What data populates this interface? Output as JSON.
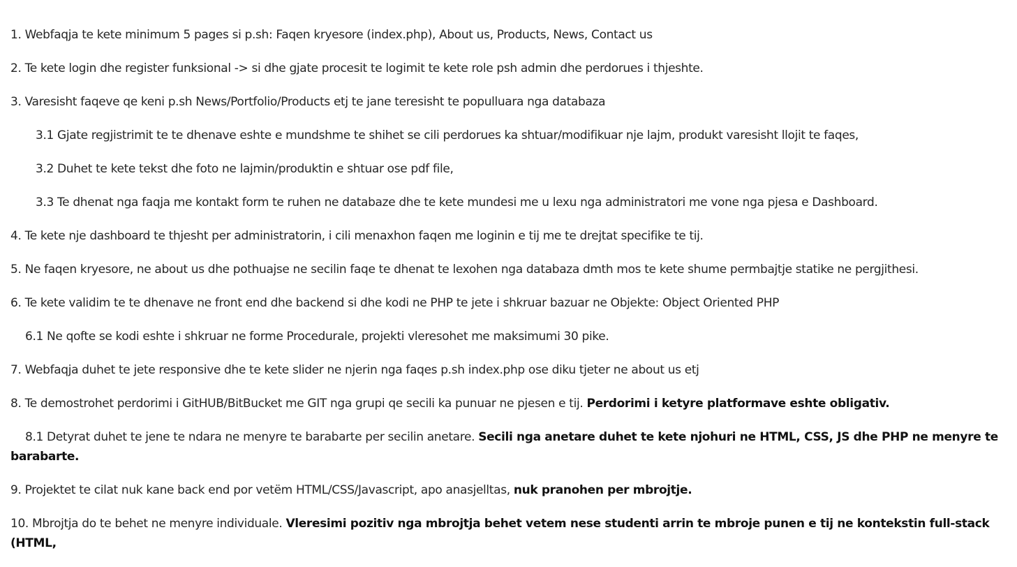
{
  "requirements": [
    {
      "text": "1. Webfaqja te kete minimum 5 pages si p.sh: Faqen kryesore (index.php), About us, Products, News, Contact us",
      "bold": ""
    },
    {
      "text": "2. Te kete login dhe register funksional -> si dhe gjate procesit te logimit te kete role psh admin dhe perdorues i thjeshte.",
      "bold": ""
    },
    {
      "text": "3. Varesisht faqeve qe keni p.sh News/Portfolio/Products etj te jane teresisht te populluara nga databaza",
      "bold": ""
    },
    {
      "text": "3.1 Gjate regjistrimit te te dhenave eshte e mundshme te shihet se cili perdorues ka shtuar/modifikuar nje lajm, produkt varesisht llojit te faqes,",
      "bold": ""
    },
    {
      "text": "3.2 Duhet te kete tekst dhe foto ne lajmin/produktin e shtuar ose pdf file,",
      "bold": ""
    },
    {
      "text": "3.3 Te dhenat nga faqja me kontakt form te ruhen ne databaze dhe te kete mundesi me u lexu nga administratori me vone nga pjesa e Dashboard.",
      "bold": ""
    },
    {
      "text": "4. Te kete nje dashboard te thjesht per administratorin, i cili menaxhon faqen me loginin e tij me te drejtat specifike te tij.",
      "bold": ""
    },
    {
      "text": "5. Ne faqen kryesore, ne about us dhe pothuajse ne secilin faqe te dhenat te lexohen nga databaza dmth mos te kete shume permbajtje statike ne pergjithesi.",
      "bold": ""
    },
    {
      "text": "6. Te kete validim te te dhenave ne front end dhe backend si dhe kodi ne PHP te jete i shkruar bazuar ne Objekte: Object Oriented PHP",
      "bold": ""
    },
    {
      "text": "6.1 Ne qofte se kodi eshte i shkruar ne forme Procedurale, projekti vleresohet me maksimumi 30 pike.",
      "bold": ""
    },
    {
      "text": "7. Webfaqja duhet te jete responsive dhe te kete slider ne njerin nga faqes p.sh index.php ose diku tjeter ne about us etj",
      "bold": ""
    },
    {
      "text": "8. Te demostrohet perdorimi i GitHUB/BitBucket me GIT nga grupi qe secili ka punuar ne pjesen e tij. ",
      "bold": "Perdorimi i ketyre platformave eshte obligativ."
    },
    {
      "text": "8.1 Detyrat duhet te jene te ndara ne menyre te barabarte per secilin anetare. ",
      "bold": "Secili nga anetare duhet te kete njohuri ne HTML, CSS, JS dhe PHP ne menyre te barabarte."
    },
    {
      "text": "9. Projektet te cilat nuk kane back end por vetëm HTML/CSS/Javascript, apo anasjelltas, ",
      "bold": "nuk pranohen per mbrojtje."
    },
    {
      "text": "10. Mbrojtja do te behet ne menyre individuale. ",
      "bold": "Vleresimi pozitiv nga mbrojtja behet vetem nese studenti arrin te mbroje punen e tij ne kontekstin full-stack (HTML,"
    }
  ]
}
